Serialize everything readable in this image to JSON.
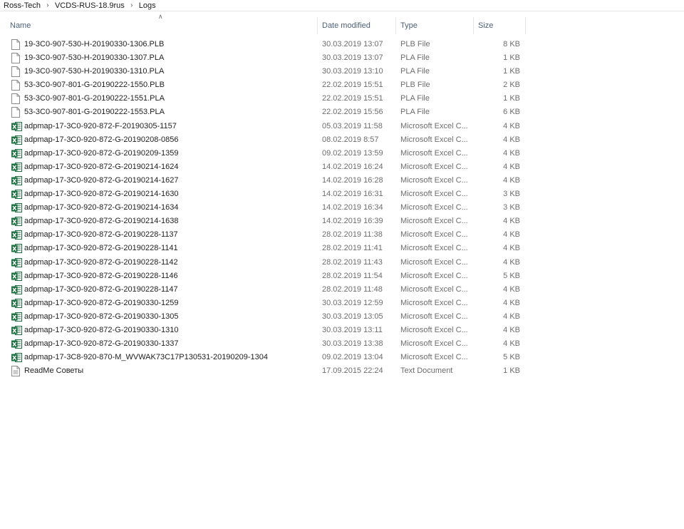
{
  "breadcrumb": {
    "items": [
      "Ross-Tech",
      "VCDS-RUS-18.9rus",
      "Logs"
    ]
  },
  "columns": {
    "name": "Name",
    "date": "Date modified",
    "type": "Type",
    "size": "Size"
  },
  "colors": {
    "excel_green": "#1d6f42",
    "header_text": "#4c607a",
    "meta_text": "#6d6d6d"
  },
  "files": [
    {
      "name": "19-3C0-907-530-H-20190330-1306.PLB",
      "date": "30.03.2019 13:07",
      "type": "PLB File",
      "size": "8 KB",
      "icon": "document-icon"
    },
    {
      "name": "19-3C0-907-530-H-20190330-1307.PLA",
      "date": "30.03.2019 13:07",
      "type": "PLA File",
      "size": "1 KB",
      "icon": "document-icon"
    },
    {
      "name": "19-3C0-907-530-H-20190330-1310.PLA",
      "date": "30.03.2019 13:10",
      "type": "PLA File",
      "size": "1 KB",
      "icon": "document-icon"
    },
    {
      "name": "53-3C0-907-801-G-20190222-1550.PLB",
      "date": "22.02.2019 15:51",
      "type": "PLB File",
      "size": "2 KB",
      "icon": "document-icon"
    },
    {
      "name": "53-3C0-907-801-G-20190222-1551.PLA",
      "date": "22.02.2019 15:51",
      "type": "PLA File",
      "size": "1 KB",
      "icon": "document-icon"
    },
    {
      "name": "53-3C0-907-801-G-20190222-1553.PLA",
      "date": "22.02.2019 15:56",
      "type": "PLA File",
      "size": "6 KB",
      "icon": "document-icon"
    },
    {
      "name": "adpmap-17-3C0-920-872-F-20190305-1157",
      "date": "05.03.2019 11:58",
      "type": "Microsoft Excel C...",
      "size": "4 KB",
      "icon": "excel-icon"
    },
    {
      "name": "adpmap-17-3C0-920-872-G-20190208-0856",
      "date": "08.02.2019 8:57",
      "type": "Microsoft Excel C...",
      "size": "4 KB",
      "icon": "excel-icon"
    },
    {
      "name": "adpmap-17-3C0-920-872-G-20190209-1359",
      "date": "09.02.2019 13:59",
      "type": "Microsoft Excel C...",
      "size": "4 KB",
      "icon": "excel-icon"
    },
    {
      "name": "adpmap-17-3C0-920-872-G-20190214-1624",
      "date": "14.02.2019 16:24",
      "type": "Microsoft Excel C...",
      "size": "4 KB",
      "icon": "excel-icon"
    },
    {
      "name": "adpmap-17-3C0-920-872-G-20190214-1627",
      "date": "14.02.2019 16:28",
      "type": "Microsoft Excel C...",
      "size": "4 KB",
      "icon": "excel-icon"
    },
    {
      "name": "adpmap-17-3C0-920-872-G-20190214-1630",
      "date": "14.02.2019 16:31",
      "type": "Microsoft Excel C...",
      "size": "3 KB",
      "icon": "excel-icon"
    },
    {
      "name": "adpmap-17-3C0-920-872-G-20190214-1634",
      "date": "14.02.2019 16:34",
      "type": "Microsoft Excel C...",
      "size": "3 KB",
      "icon": "excel-icon"
    },
    {
      "name": "adpmap-17-3C0-920-872-G-20190214-1638",
      "date": "14.02.2019 16:39",
      "type": "Microsoft Excel C...",
      "size": "4 KB",
      "icon": "excel-icon"
    },
    {
      "name": "adpmap-17-3C0-920-872-G-20190228-1137",
      "date": "28.02.2019 11:38",
      "type": "Microsoft Excel C...",
      "size": "4 KB",
      "icon": "excel-icon"
    },
    {
      "name": "adpmap-17-3C0-920-872-G-20190228-1141",
      "date": "28.02.2019 11:41",
      "type": "Microsoft Excel C...",
      "size": "4 KB",
      "icon": "excel-icon"
    },
    {
      "name": "adpmap-17-3C0-920-872-G-20190228-1142",
      "date": "28.02.2019 11:43",
      "type": "Microsoft Excel C...",
      "size": "4 KB",
      "icon": "excel-icon"
    },
    {
      "name": "adpmap-17-3C0-920-872-G-20190228-1146",
      "date": "28.02.2019 11:54",
      "type": "Microsoft Excel C...",
      "size": "5 KB",
      "icon": "excel-icon"
    },
    {
      "name": "adpmap-17-3C0-920-872-G-20190228-1147",
      "date": "28.02.2019 11:48",
      "type": "Microsoft Excel C...",
      "size": "4 KB",
      "icon": "excel-icon"
    },
    {
      "name": "adpmap-17-3C0-920-872-G-20190330-1259",
      "date": "30.03.2019 12:59",
      "type": "Microsoft Excel C...",
      "size": "4 KB",
      "icon": "excel-icon"
    },
    {
      "name": "adpmap-17-3C0-920-872-G-20190330-1305",
      "date": "30.03.2019 13:05",
      "type": "Microsoft Excel C...",
      "size": "4 KB",
      "icon": "excel-icon"
    },
    {
      "name": "adpmap-17-3C0-920-872-G-20190330-1310",
      "date": "30.03.2019 13:11",
      "type": "Microsoft Excel C...",
      "size": "4 KB",
      "icon": "excel-icon"
    },
    {
      "name": "adpmap-17-3C0-920-872-G-20190330-1337",
      "date": "30.03.2019 13:38",
      "type": "Microsoft Excel C...",
      "size": "4 KB",
      "icon": "excel-icon"
    },
    {
      "name": "adpmap-17-3C8-920-870-M_WVWAK73C17P130531-20190209-1304",
      "date": "09.02.2019 13:04",
      "type": "Microsoft Excel C...",
      "size": "5 KB",
      "icon": "excel-icon"
    },
    {
      "name": "ReadMe Советы",
      "date": "17.09.2015 22:24",
      "type": "Text Document",
      "size": "1 KB",
      "icon": "text-document-icon"
    }
  ]
}
